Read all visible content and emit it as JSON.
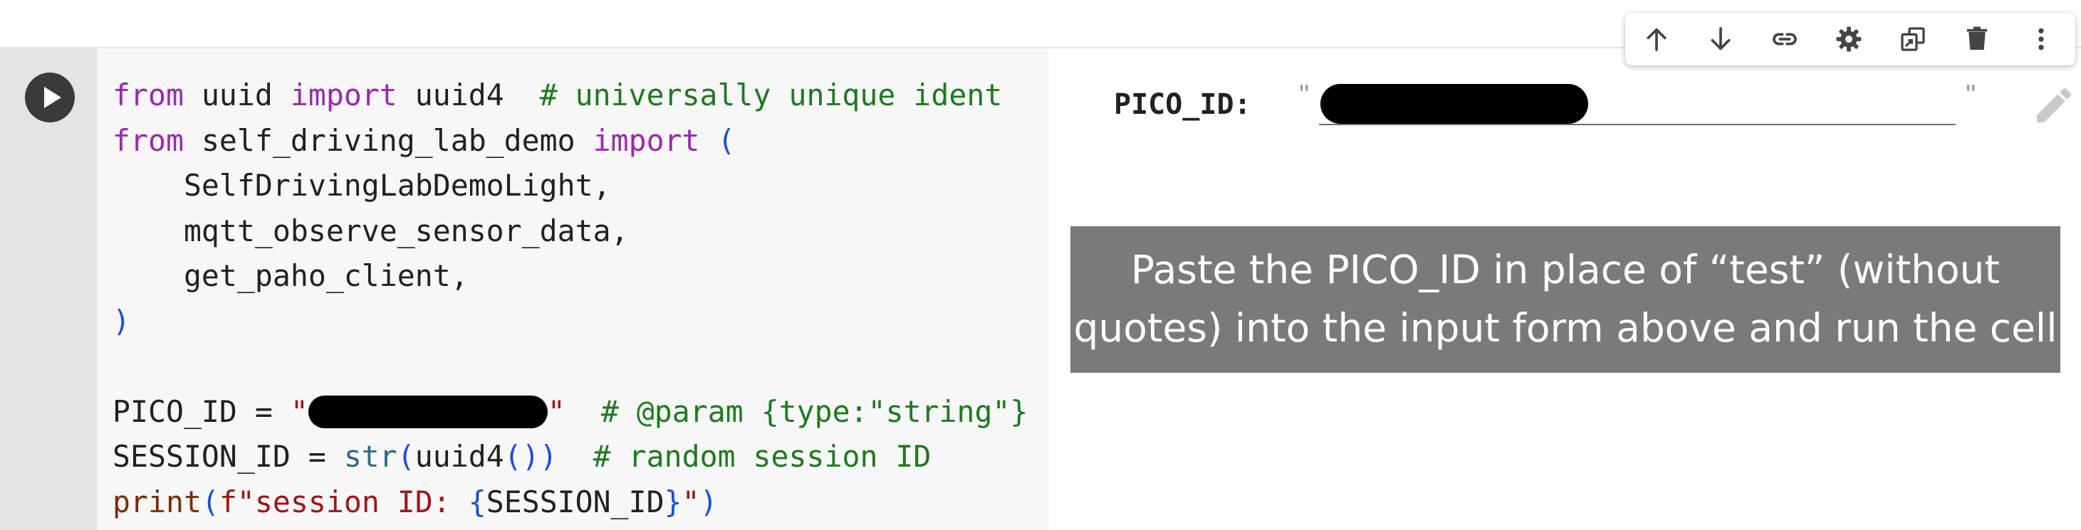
{
  "code_cell": {
    "run_label": "Run cell",
    "lines": [
      [
        [
          "kw",
          "from"
        ],
        [
          "p",
          " uuid "
        ],
        [
          "kw",
          "import"
        ],
        [
          "p",
          " uuid4  "
        ],
        [
          "cm",
          "# universally unique ident"
        ]
      ],
      [
        [
          "kw",
          "from"
        ],
        [
          "p",
          " self_driving_lab_demo "
        ],
        [
          "kw",
          "import"
        ],
        [
          "p",
          " "
        ],
        [
          "pn",
          "("
        ]
      ],
      [
        [
          "p",
          "    SelfDrivingLabDemoLight,"
        ]
      ],
      [
        [
          "p",
          "    mqtt_observe_sensor_data,"
        ]
      ],
      [
        [
          "p",
          "    get_paho_client,"
        ]
      ],
      [
        [
          "pn",
          ")"
        ]
      ],
      [],
      [
        [
          "p",
          "PICO_ID = "
        ],
        [
          "st",
          "\""
        ],
        [
          "redact",
          ""
        ],
        [
          "st",
          "\""
        ],
        [
          "p",
          "  "
        ],
        [
          "cm",
          "# @param {type:\"string\"}"
        ]
      ],
      [
        [
          "p",
          "SESSION_ID = "
        ],
        [
          "fn",
          "str"
        ],
        [
          "pn",
          "("
        ],
        [
          "p",
          "uuid4"
        ],
        [
          "pn",
          "())"
        ],
        [
          "p",
          "  "
        ],
        [
          "cm",
          "# random session ID"
        ]
      ],
      [
        [
          "fb",
          "print"
        ],
        [
          "pn",
          "("
        ],
        [
          "st",
          "f\"session ID: "
        ],
        [
          "pn",
          "{"
        ],
        [
          "p",
          "SESSION_ID"
        ],
        [
          "pn",
          "}"
        ],
        [
          "st",
          "\""
        ],
        [
          "pn",
          ")"
        ]
      ]
    ]
  },
  "form": {
    "label": "PICO_ID:",
    "open_quote": "\"",
    "close_quote": "\"",
    "value": "",
    "edit_icon": "pencil-icon"
  },
  "annotation": {
    "line1": "Paste the PICO_ID in place of “test” (without",
    "line2": "quotes) into the input form above and run the cell"
  },
  "toolbar": {
    "buttons": [
      {
        "name": "move-up-button",
        "icon": "arrow-up-icon"
      },
      {
        "name": "move-down-button",
        "icon": "arrow-down-icon"
      },
      {
        "name": "link-button",
        "icon": "link-icon"
      },
      {
        "name": "settings-button",
        "icon": "gear-icon"
      },
      {
        "name": "mirror-cell-button",
        "icon": "mirror-icon"
      },
      {
        "name": "delete-button",
        "icon": "trash-icon"
      },
      {
        "name": "more-options-button",
        "icon": "kebab-icon"
      }
    ]
  },
  "colors": {
    "keyword": "#9c27b0",
    "comment": "#1e7a1e",
    "string": "#a31515",
    "paren": "#1a4fd8",
    "gutter": "#e4e4e4",
    "banner": "#7a7a7a"
  }
}
